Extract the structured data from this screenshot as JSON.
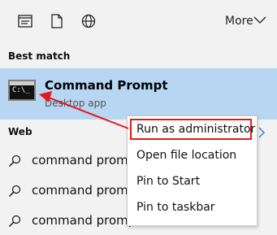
{
  "toolbar": {
    "icons": [
      "document-list-icon",
      "file-icon",
      "globe-icon"
    ],
    "more_label": "More"
  },
  "best_match": {
    "section_title": "Best match",
    "title": "Command Prompt",
    "subtitle": "Desktop app",
    "icon_text": "C:\\_"
  },
  "web": {
    "section_title": "Web",
    "results": [
      {
        "label": "command prompt"
      },
      {
        "label": "command prompt"
      },
      {
        "label": "command prompt"
      }
    ]
  },
  "context_menu": {
    "items": [
      {
        "label": "Run as administrator"
      },
      {
        "label": "Open file location"
      },
      {
        "label": "Pin to Start"
      },
      {
        "label": "Pin to taskbar"
      }
    ]
  },
  "colors": {
    "selection": "#b7d6f2",
    "annotation": "#e21b1b"
  }
}
